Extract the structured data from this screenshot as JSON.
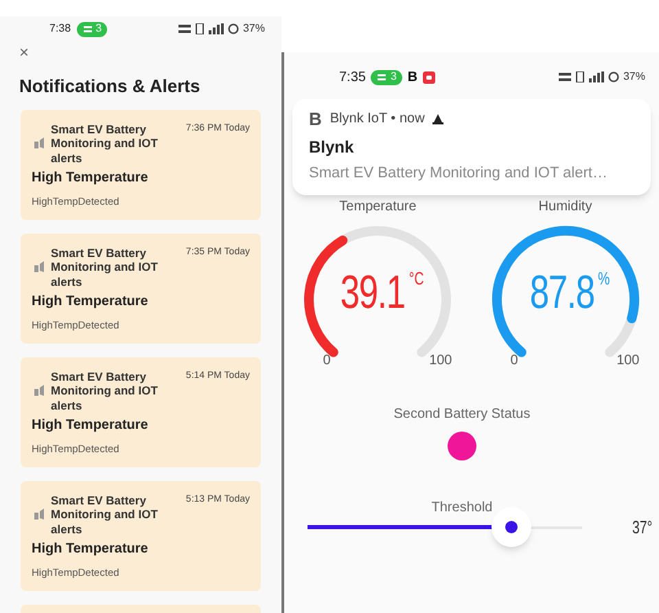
{
  "left_screen": {
    "status_bar": {
      "time": "7:38",
      "badge": "3",
      "battery": "37%"
    },
    "close_label": "×",
    "title": "Notifications & Alerts",
    "notifications": [
      {
        "app": "Smart EV Battery Monitoring and IOT alerts",
        "time": "7:36 PM Today",
        "title": "High Temperature",
        "body": "HighTempDetected"
      },
      {
        "app": "Smart EV Battery Monitoring and IOT alerts",
        "time": "7:35 PM Today",
        "title": "High Temperature",
        "body": "HighTempDetected"
      },
      {
        "app": "Smart EV Battery Monitoring and IOT alerts",
        "time": "5:14 PM Today",
        "title": "High Temperature",
        "body": "HighTempDetected"
      },
      {
        "app": "Smart EV Battery Monitoring and IOT alerts",
        "time": "5:13 PM Today",
        "title": "High Temperature",
        "body": "HighTempDetected"
      }
    ]
  },
  "right_screen": {
    "status_bar": {
      "time": "7:35",
      "badge": "3",
      "app_letter": "B",
      "battery": "37%"
    },
    "heads_up": {
      "logo": "B",
      "app": "Blynk IoT • now",
      "title": "Blynk",
      "text": "Smart EV Battery Monitoring and IOT alert…"
    },
    "gauges": [
      {
        "label": "Temperature",
        "value": "39.1",
        "unit": "°C",
        "color": "#ef2b2b",
        "min": "0",
        "max": "100"
      },
      {
        "label": "Humidity",
        "value": "87.8",
        "unit": "%",
        "color": "#1a9bf0",
        "min": "0",
        "max": "100"
      }
    ],
    "led": {
      "label": "Second Battery Status",
      "color": "#f0169a"
    },
    "slider": {
      "label": "Threshold",
      "level": 0.74,
      "value": "37°"
    }
  }
}
